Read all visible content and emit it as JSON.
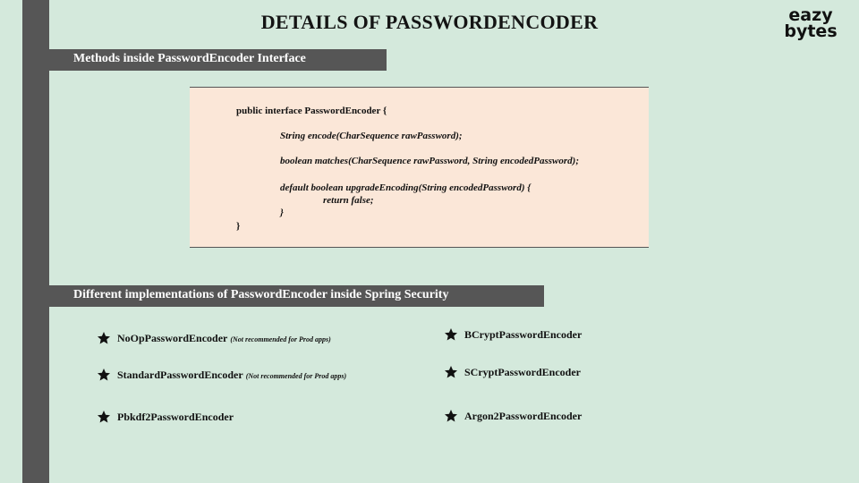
{
  "title": "DETAILS OF PASSWORDENCODER",
  "logo": {
    "line1": "eazy",
    "line2": "bytes"
  },
  "section1": {
    "header": "Methods inside PasswordEncoder Interface"
  },
  "code": {
    "lines": [
      "public interface PasswordEncoder {",
      "String encode(CharSequence rawPassword);",
      "boolean matches(CharSequence rawPassword, String encodedPassword);",
      "default boolean upgradeEncoding(String encodedPassword) {",
      "return false;",
      "}",
      "}"
    ]
  },
  "section2": {
    "header": "Different implementations of PasswordEncoder inside Spring Security",
    "items": [
      {
        "label": "NoOpPasswordEncoder",
        "note": "(Not recommended for Prod apps)",
        "icon": "star-icon"
      },
      {
        "label": "StandardPasswordEncoder",
        "note": "(Not recommended for Prod apps)",
        "icon": "star-icon"
      },
      {
        "label": "Pbkdf2PasswordEncoder",
        "note": "",
        "icon": "star-icon"
      },
      {
        "label": "BCryptPasswordEncoder",
        "note": "",
        "icon": "star-icon"
      },
      {
        "label": "SCryptPasswordEncoder",
        "note": "",
        "icon": "star-icon"
      },
      {
        "label": "Argon2PasswordEncoder",
        "note": "",
        "icon": "star-icon"
      }
    ]
  },
  "colors": {
    "background": "#d4e9dc",
    "bar": "#565656",
    "code_background": "#fbe7d8"
  }
}
